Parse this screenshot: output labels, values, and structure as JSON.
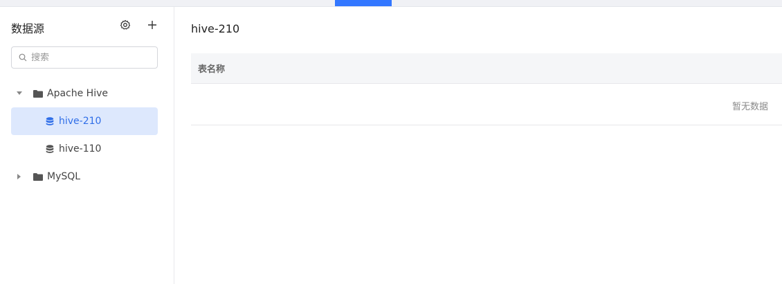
{
  "sidebar": {
    "title": "数据源",
    "search": {
      "placeholder": "搜索",
      "value": ""
    },
    "tree": [
      {
        "label": "Apache Hive",
        "expanded": true,
        "children": [
          {
            "label": "hive-210",
            "selected": true
          },
          {
            "label": "hive-110",
            "selected": false
          }
        ]
      },
      {
        "label": "MySQL",
        "expanded": false,
        "children": []
      }
    ]
  },
  "main": {
    "title": "hive-210",
    "table": {
      "columns": [
        "表名称"
      ],
      "empty_text": "暂无数据"
    }
  },
  "colors": {
    "accent": "#3377ff",
    "selected_bg": "#dde8fd",
    "selected_text": "#2f6ee8"
  }
}
